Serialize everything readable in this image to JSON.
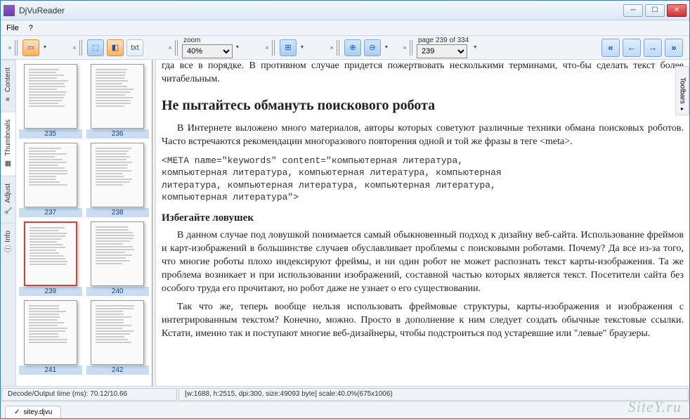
{
  "window": {
    "title": "DjVuReader"
  },
  "menu": {
    "file": "File",
    "help": "?"
  },
  "toolbar": {
    "zoom_label": "zoom",
    "zoom_value": "40%",
    "page_label": "page 239 of 334",
    "page_value": "239",
    "txt_label": "txt"
  },
  "sidebar": {
    "tabs": [
      "Content",
      "Thumbnails",
      "Adjust",
      "Info"
    ]
  },
  "thumbnails": [
    {
      "page": "235"
    },
    {
      "page": "236"
    },
    {
      "page": "237"
    },
    {
      "page": "238"
    },
    {
      "page": "239",
      "selected": true
    },
    {
      "page": "240"
    },
    {
      "page": "241"
    },
    {
      "page": "242"
    }
  ],
  "right_panel": {
    "label": "Toolbars"
  },
  "document": {
    "line1": "гда все в порядке. В противном случае придется пожертвовать несколькими терминами, что-бы сделать текст более читабельным.",
    "heading1": "Не пытайтесь обмануть поискового робота",
    "para1": "В Интернете выложено много материалов, авторы которых советуют различные техники обмана поисковых роботов. Часто встречаются рекомендации многоразового повторения одной и той же фразы в теге <meta>.",
    "code1": "<META name=\"keywords\" content=\"компьютерная литература,\nкомпьютерная литература, компьютерная литература, компьютерная\nлитература, компьютерная литература, компьютерная литература,\nкомпьютерная литература\">",
    "heading2": "Избегайте ловушек",
    "para2": "В данном случае под ловушкой понимается самый обыкновенный подход к дизайну веб-сайта. Использование фреймов и карт-изображений в большинстве случаев обуславливает проблемы с поисковыми роботами. Почему? Да все из-за того, что многие роботы плохо индексируют фреймы, и ни один робот не может распознать текст карты-изображения. Та же проблема возникает и при использовании изображений, составной частью которых является текст. Посетители сайта без особого труда его прочитают, но робот даже не узнает о его существовании.",
    "para3": "Так что же, теперь вообще нельзя использовать фреймовые структуры, карты-изображения и изображения с интегрированным текстом? Конечно, можно. Просто в дополнение к ним следует создать обычные текстовые ссылки. Кстати, именно так и поступают многие веб-дизайнеры, чтобы подстроиться под устаревшие или \"левые\" браузеры."
  },
  "status": {
    "left": "Decode/Output time (ms): 70.12/10.66",
    "right": "[w:1688, h:2515, dpi:300, size:49093 byte] scale:40.0%(675x1006)"
  },
  "file_tab": {
    "name": "sitey.djvu"
  },
  "watermark": "SiteY.ru"
}
